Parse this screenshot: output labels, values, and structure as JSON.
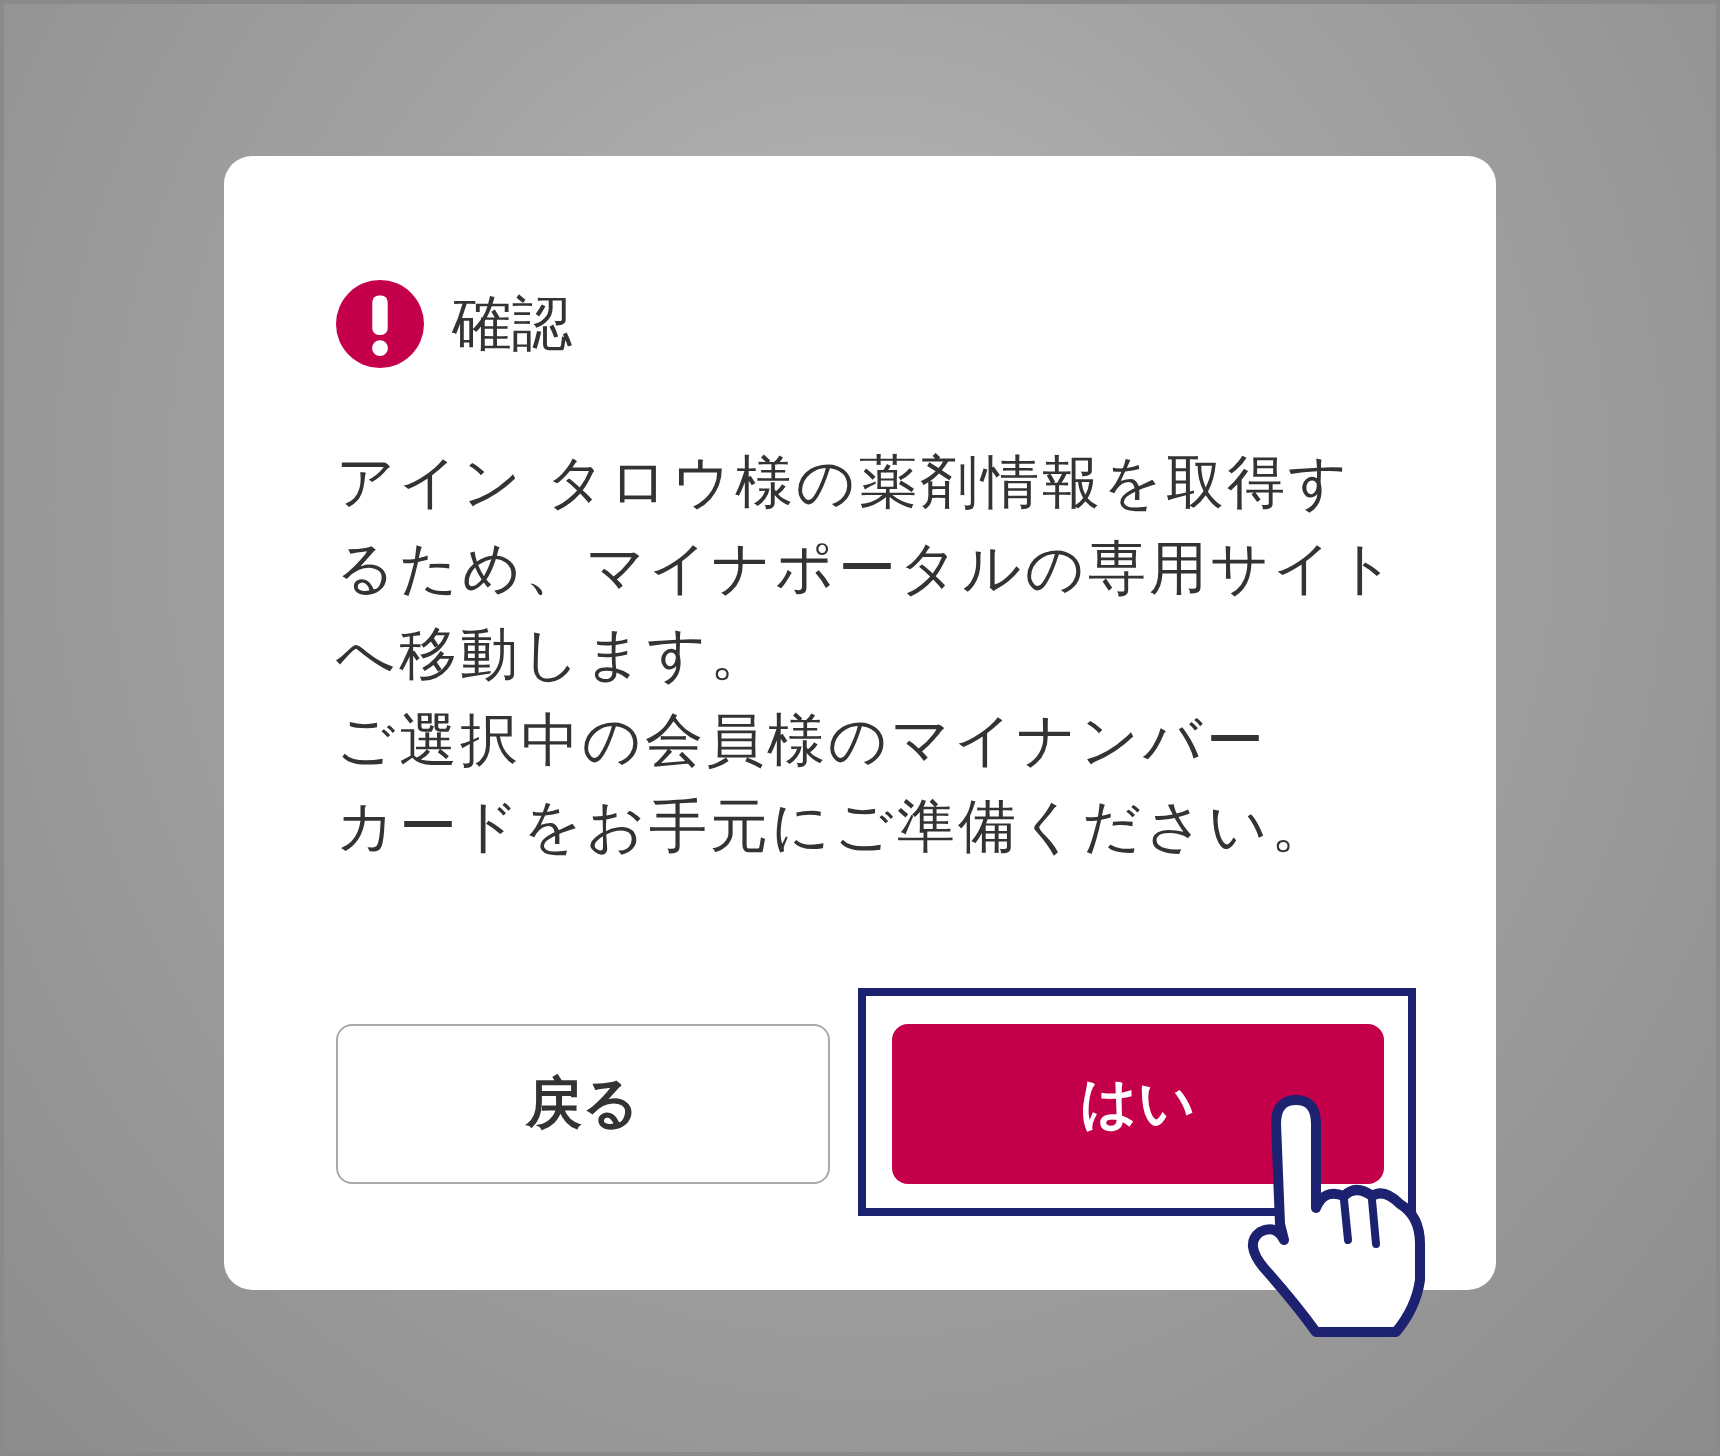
{
  "dialog": {
    "title": "確認",
    "paragraphs": [
      [
        "アイン タロウ様の薬剤情報を取得す",
        "るため、マイナポータルの専用サイト",
        "へ移動します。"
      ],
      [
        "ご選択中の会員様のマイナンバー",
        "カードをお手元にご準備ください。"
      ]
    ],
    "buttons": [
      {
        "label": "戻る",
        "kind": "secondary",
        "highlighted": false
      },
      {
        "label": "はい",
        "kind": "primary",
        "highlighted": true
      }
    ]
  }
}
